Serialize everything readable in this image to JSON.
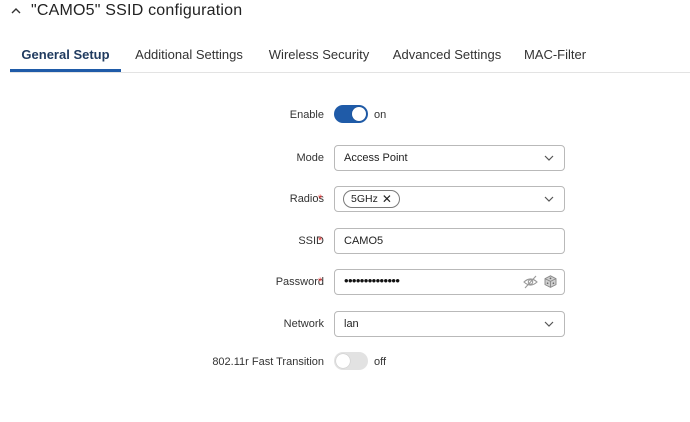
{
  "header": {
    "title": "\"CAMO5\" SSID configuration"
  },
  "tabs": [
    {
      "label": "General Setup",
      "active": true
    },
    {
      "label": "Additional Settings",
      "active": false
    },
    {
      "label": "Wireless Security",
      "active": false
    },
    {
      "label": "Advanced Settings",
      "active": false
    },
    {
      "label": "MAC-Filter",
      "active": false
    }
  ],
  "form": {
    "enable": {
      "label": "Enable",
      "state_text": "on"
    },
    "mode": {
      "label": "Mode",
      "value": "Access Point"
    },
    "radios": {
      "label": "Radios",
      "required": "*",
      "chip": "5GHz",
      "chip_remove": "✕"
    },
    "ssid": {
      "label": "SSID",
      "required": "*",
      "value": "CAMO5"
    },
    "password": {
      "label": "Password",
      "required": "*",
      "masked_value": "••••••••••••••"
    },
    "network": {
      "label": "Network",
      "value": "lan"
    },
    "fast_transition": {
      "label": "802.11r Fast Transition",
      "state_text": "off"
    }
  },
  "colors": {
    "accent": "#1f5ba8",
    "required": "#d33333"
  }
}
